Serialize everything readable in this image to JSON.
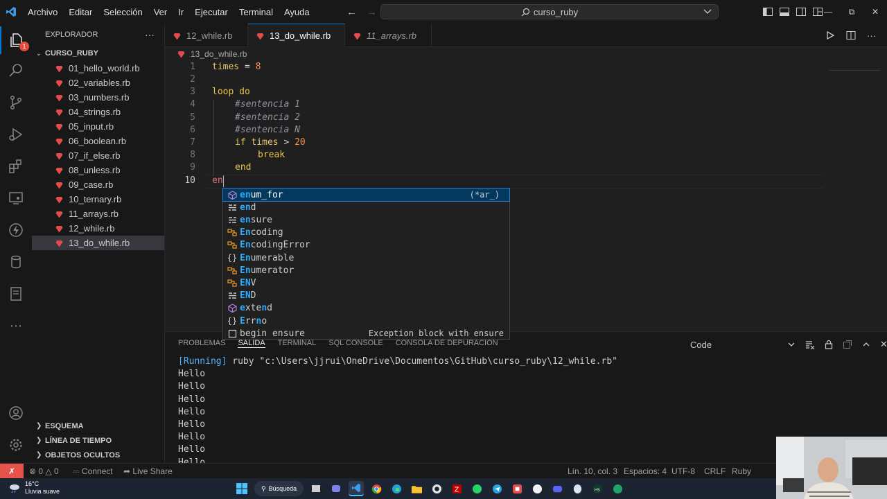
{
  "titlebar": {
    "menu": [
      "Archivo",
      "Editar",
      "Selección",
      "Ver",
      "Ir",
      "Ejecutar",
      "Terminal",
      "Ayuda"
    ],
    "search": "curso_ruby"
  },
  "sidebar": {
    "title": "EXPLORADOR",
    "folder": "CURSO_RUBY",
    "files": [
      "01_hello_world.rb",
      "02_variables.rb",
      "03_numbers.rb",
      "04_strings.rb",
      "05_input.rb",
      "06_boolean.rb",
      "07_if_else.rb",
      "08_unless.rb",
      "09_case.rb",
      "10_ternary.rb",
      "11_arrays.rb",
      "12_while.rb",
      "13_do_while.rb"
    ],
    "selected": "13_do_while.rb",
    "sections": [
      "ESQUEMA",
      "LÍNEA DE TIEMPO",
      "OBJETOS OCULTOS"
    ],
    "badge": "1"
  },
  "tabs": [
    {
      "label": "12_while.rb"
    },
    {
      "label": "13_do_while.rb"
    },
    {
      "label": "11_arrays.rb"
    }
  ],
  "breadcrumb": "13_do_while.rb",
  "editor": {
    "line_numbers": [
      "1",
      "2",
      "3",
      "4",
      "5",
      "6",
      "7",
      "8",
      "9",
      "10"
    ],
    "lines": {
      "l1_var": "times",
      "l1_op": " = ",
      "l1_num": "8",
      "l3": "loop do",
      "l4": "#sentencia 1",
      "l5": "#sentencia 2",
      "l6": "#sentencia N",
      "l7_kw": "if",
      "l7_var": "times",
      "l7_op": " > ",
      "l7_num": "20",
      "l8": "break",
      "l9": "end",
      "l10": "en"
    }
  },
  "suggest": [
    {
      "icon": "method-icon",
      "match": "en",
      "rest": "um_for",
      "detail": "(*ar_)"
    },
    {
      "icon": "keyword-icon",
      "match": "en",
      "rest": "d",
      "detail": ""
    },
    {
      "icon": "keyword-icon",
      "match": "en",
      "rest": "sure",
      "detail": ""
    },
    {
      "icon": "class-icon",
      "match": "En",
      "rest": "coding",
      "detail": ""
    },
    {
      "icon": "class-icon",
      "match": "En",
      "rest": "codingError",
      "detail": ""
    },
    {
      "icon": "module-icon",
      "match": "En",
      "rest": "umerable",
      "detail": ""
    },
    {
      "icon": "class-icon",
      "match": "En",
      "rest": "umerator",
      "detail": ""
    },
    {
      "icon": "class-icon",
      "match": "EN",
      "rest": "V",
      "detail": ""
    },
    {
      "icon": "keyword-icon",
      "match": "EN",
      "rest": "D",
      "detail": ""
    },
    {
      "icon": "method-icon",
      "match": "e",
      "rest": "xte",
      "rest2": "n",
      "rest3": "d",
      "detail": ""
    },
    {
      "icon": "module-icon",
      "match": "E",
      "rest": "rr",
      "rest2": "n",
      "rest3": "o",
      "detail": ""
    },
    {
      "icon": "snippet-icon",
      "match": "",
      "rest": "begin ensure",
      "detail": "Exception block with ensure"
    }
  ],
  "panel": {
    "tabs": [
      "PROBLEMAS",
      "SALIDA",
      "TERMINAL",
      "SQL CONSOLE",
      "CONSOLA DE DEPURACIÓN"
    ],
    "active_tab": "SALIDA",
    "channel": "Code",
    "running_tag": "[Running]",
    "command": " ruby \"c:\\Users\\jjrui\\OneDrive\\Documentos\\GitHub\\curso_ruby\\12_while.rb\"",
    "output_lines": [
      "Hello",
      "Hello",
      "Hello",
      "Hello",
      "Hello",
      "Hello",
      "Hello",
      "Hello"
    ]
  },
  "statusbar": {
    "errors": "0",
    "warnings": "0",
    "connect": "Connect",
    "live_share": "Live Share",
    "position": "Lín. 10, col. 3",
    "spaces": "Espacios: 4",
    "encoding": "UTF-8",
    "eol": "CRLF",
    "language": "Ruby"
  },
  "taskbar": {
    "temp": "16°C",
    "weather": "Lluvia suave",
    "search": "Búsqueda"
  },
  "colors": {
    "accent": "#0078d4",
    "ruby_red": "#e34c4c",
    "keyword": "#e7c547",
    "number": "#f58b4c",
    "match": "#2aaaff"
  }
}
